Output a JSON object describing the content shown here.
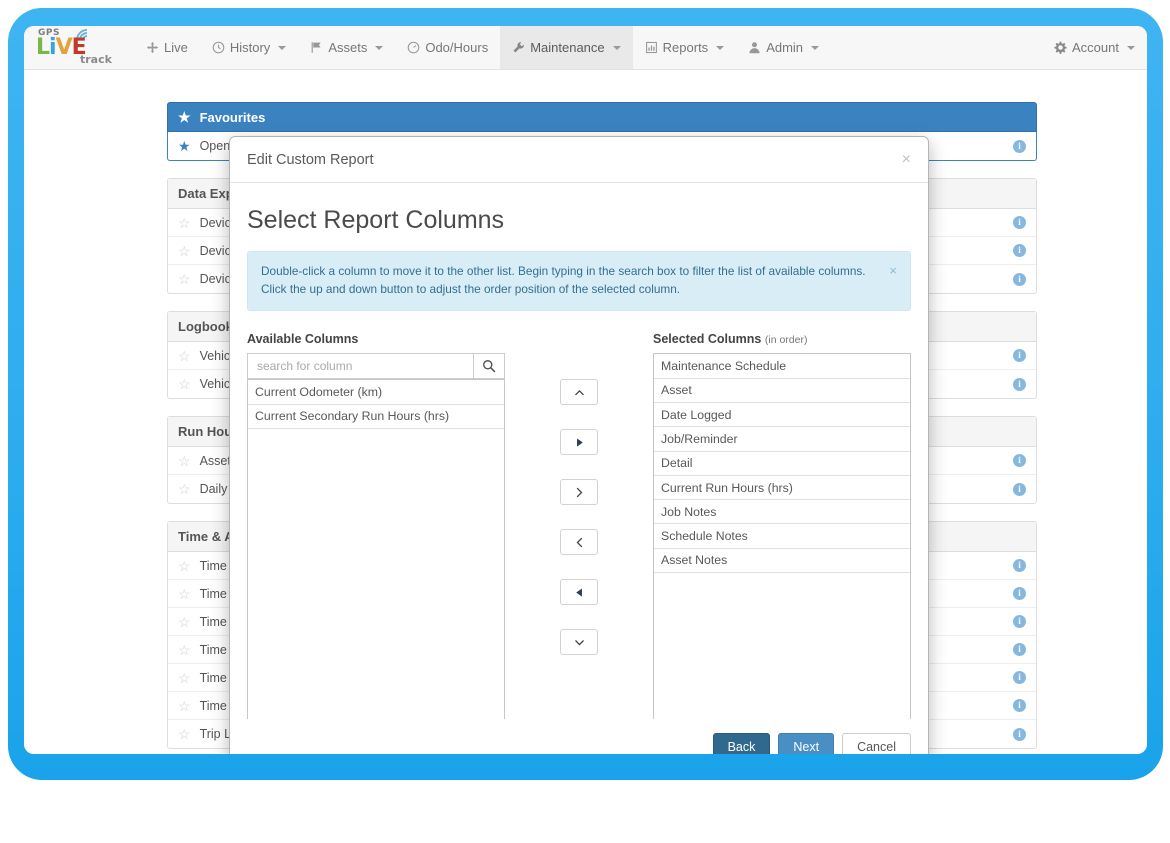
{
  "navbar": {
    "brand": {
      "gps": "GPS",
      "live": "LiVE",
      "track": "track"
    },
    "items": [
      {
        "label": "Live",
        "icon": "move-icon",
        "caret": false,
        "active": false
      },
      {
        "label": "History",
        "icon": "clock-icon",
        "caret": true,
        "active": false
      },
      {
        "label": "Assets",
        "icon": "flag-icon",
        "caret": true,
        "active": false
      },
      {
        "label": "Odo/Hours",
        "icon": "gauge-icon",
        "caret": false,
        "active": false
      },
      {
        "label": "Maintenance",
        "icon": "wrench-icon",
        "caret": true,
        "active": true
      },
      {
        "label": "Reports",
        "icon": "report-icon",
        "caret": true,
        "active": false
      },
      {
        "label": "Admin",
        "icon": "user-icon",
        "caret": true,
        "active": false
      }
    ],
    "account": {
      "label": "Account",
      "icon": "gear-icon",
      "caret": true
    }
  },
  "background_page": {
    "favourites": {
      "header": "Favourites",
      "rows": [
        "Open M"
      ]
    },
    "groups": [
      {
        "header": "Data Export",
        "rows": [
          "Device",
          "Device",
          "Device"
        ]
      },
      {
        "header": "Logbooks",
        "rows": [
          "Vehicle",
          "Vehicle"
        ]
      },
      {
        "header": "Run Hour",
        "rows": [
          "Asset R",
          "Daily R"
        ]
      },
      {
        "header": "Time & Att",
        "rows": [
          "Time A",
          "Time A",
          "Time A",
          "Time A",
          "Time A",
          "Time A"
        ]
      }
    ],
    "bottom_row": "Trip List Data Export (GPX/KML)"
  },
  "modal": {
    "title": "Edit Custom Report",
    "close_label": "×",
    "section_title": "Select Report Columns",
    "alert": {
      "text": "Double-click a column to move it to the other list. Begin typing in the search box to filter the list of available columns. Click the up and down button to adjust the order position of the selected column.",
      "close_label": "×"
    },
    "available": {
      "label": "Available Columns",
      "search_placeholder": "search for column",
      "search_value": "",
      "search_icon": "search-icon",
      "items": [
        "Current Odometer (km)",
        "Current Secondary Run Hours (hrs)"
      ]
    },
    "selected": {
      "label": "Selected Columns",
      "sublabel": "(in order)",
      "items": [
        "Maintenance Schedule",
        "Asset",
        "Date Logged",
        "Job/Reminder",
        "Detail",
        "Current Run Hours (hrs)",
        "Job Notes",
        "Schedule Notes",
        "Asset Notes"
      ]
    },
    "transfer_buttons": [
      {
        "name": "move-up-button",
        "icon": "chevron-up-icon"
      },
      {
        "name": "move-all-right-button",
        "icon": "triangle-right-icon"
      },
      {
        "name": "move-right-button",
        "icon": "chevron-right-icon"
      },
      {
        "name": "move-left-button",
        "icon": "chevron-left-icon"
      },
      {
        "name": "move-all-left-button",
        "icon": "triangle-left-icon"
      },
      {
        "name": "move-down-button",
        "icon": "chevron-down-icon"
      }
    ],
    "footer": {
      "back": "Back",
      "next": "Next",
      "cancel": "Cancel"
    }
  },
  "colors": {
    "bezel": "#2bacef",
    "primary": "#3b83c0",
    "back_button": "#31688e",
    "next_button": "#4a8fc4",
    "alert_bg": "#d9edf7",
    "alert_text": "#31708f"
  }
}
